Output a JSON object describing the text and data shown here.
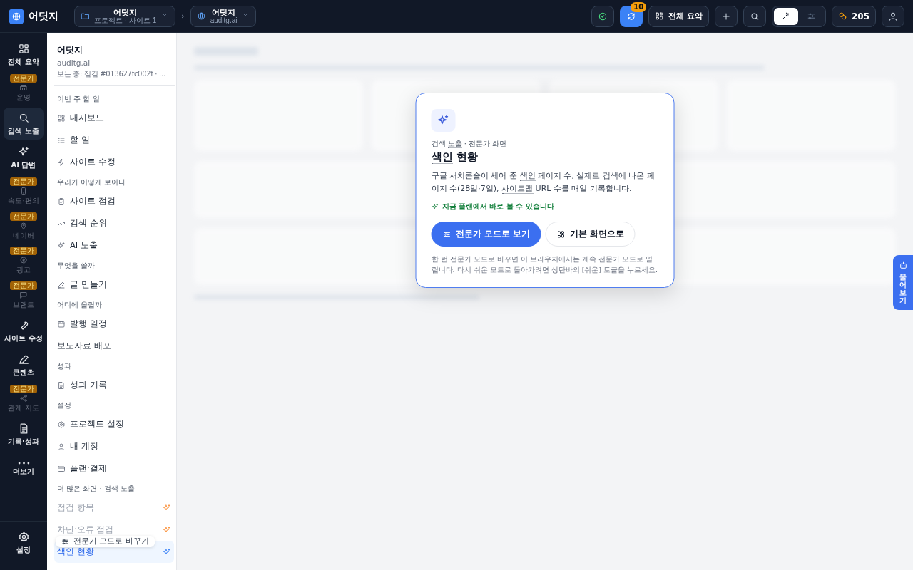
{
  "topbar": {
    "logo": "어딧지",
    "project": {
      "name": "어딧지",
      "sub": "프로젝트 · 사이트 1"
    },
    "separator": "›",
    "site": {
      "name": "어딧지",
      "sub": "auditg.ai"
    },
    "sync_badge": "10",
    "summary_button": "전체 요약",
    "mode_toggle": [
      {
        "selected": true
      },
      {
        "selected": false
      }
    ],
    "credits": "205"
  },
  "rail": {
    "items": [
      {
        "label": "전체 요약",
        "selected": false,
        "disabled": false
      },
      {
        "label": "운영",
        "badge": "전문가",
        "selected": false,
        "disabled": true
      },
      {
        "label": "검색 노출",
        "selected": true,
        "disabled": false
      },
      {
        "label": "AI 답변",
        "selected": false,
        "disabled": false
      },
      {
        "label": "속도·편의",
        "badge": "전문가",
        "selected": false,
        "disabled": true
      },
      {
        "label": "네이버",
        "badge": "전문가",
        "selected": false,
        "disabled": true
      },
      {
        "label": "광고",
        "badge": "전문가",
        "selected": false,
        "disabled": true
      },
      {
        "label": "브랜드",
        "badge": "전문가",
        "selected": false,
        "disabled": true
      },
      {
        "label": "사이트 수정",
        "selected": false,
        "disabled": false
      },
      {
        "label": "콘텐츠",
        "selected": false,
        "disabled": false
      },
      {
        "label": "관계 지도",
        "badge": "전문가",
        "selected": false,
        "disabled": true
      },
      {
        "label": "기록·성과",
        "selected": false,
        "disabled": false
      },
      {
        "label": "더보기",
        "selected": false,
        "disabled": false
      }
    ],
    "settings": {
      "label": "설정"
    }
  },
  "sidebar": {
    "name": "어딧지",
    "domain": "auditg.ai",
    "viewing": "보는 중: 점검 #013627fc002f · ...",
    "sections": [
      {
        "title": "이번 주 할 일",
        "items": [
          {
            "label": "대시보드",
            "selected": false,
            "disabled": false
          },
          {
            "label": "할 일",
            "selected": false,
            "disabled": false
          },
          {
            "label": "사이트 수정",
            "selected": false,
            "disabled": false
          }
        ]
      },
      {
        "title": "우리가 어떻게 보이나",
        "items": [
          {
            "label": "사이트 점검",
            "selected": false,
            "disabled": false
          },
          {
            "label": "검색 순위",
            "selected": false,
            "disabled": false
          },
          {
            "label": "AI 노출",
            "selected": false,
            "disabled": false
          }
        ]
      },
      {
        "title": "무엇을 쓸까",
        "items": [
          {
            "label": "글 만들기",
            "selected": false,
            "disabled": false
          }
        ]
      },
      {
        "title": "어디에 올릴까",
        "items": [
          {
            "label": "발행 일정",
            "selected": false,
            "disabled": false
          },
          {
            "label": "보도자료 배포",
            "selected": false,
            "disabled": false
          }
        ]
      },
      {
        "title": "성과",
        "items": [
          {
            "label": "성과 기록",
            "selected": false,
            "disabled": false
          }
        ]
      },
      {
        "title": "설정",
        "items": [
          {
            "label": "프로젝트 설정",
            "selected": false,
            "disabled": false
          },
          {
            "label": "내 계정",
            "selected": false,
            "disabled": false
          },
          {
            "label": "플랜·결제",
            "selected": false,
            "disabled": false
          }
        ]
      },
      {
        "title": "더 많은 화면 · 검색 노출",
        "items": [
          {
            "label": "점검 항목",
            "expert": true,
            "selected": false,
            "disabled": true
          },
          {
            "label": "차단·오류 점검",
            "expert": true,
            "selected": false,
            "disabled": true
          },
          {
            "label": "색인 현황",
            "expert": true,
            "selected": true,
            "disabled": false
          }
        ]
      }
    ],
    "tooltip": "전문가 모드로 바꾸기"
  },
  "modal": {
    "category": [
      {
        "text": "검색 ",
        "term": false
      },
      {
        "text": "노출",
        "term": true
      },
      {
        "text": " · 전문가 화면",
        "term": false
      }
    ],
    "title": [
      {
        "text": "색인",
        "term": true
      },
      {
        "text": " 현황",
        "term": false
      }
    ],
    "description": [
      {
        "text": "구글 서치콘솔이 세어 준 ",
        "term": false
      },
      {
        "text": "색인",
        "term": true
      },
      {
        "text": " 페이지 수, 실제로 검색에 나온 페이지 수(28일·7일), ",
        "term": false
      },
      {
        "text": "사이트맵",
        "term": true
      },
      {
        "text": " URL 수를 매일 기록합니다.",
        "term": false
      }
    ],
    "note": "지금 플랜에서 바로 볼 수 있습니다",
    "buttons": [
      {
        "label": "전문가 모드로 보기",
        "kind": "primary"
      },
      {
        "label": "기본 화면으로",
        "kind": "secondary"
      }
    ],
    "footnote": "한 번 전문가 모드로 바꾸면 이 브라우저에서는 계속 전문가 모드로 열립니다. 다시 쉬운 모드로 돌아가려면 상단바의 [쉬운] 토글을 누르세요."
  },
  "ask_button": "물어보기"
}
